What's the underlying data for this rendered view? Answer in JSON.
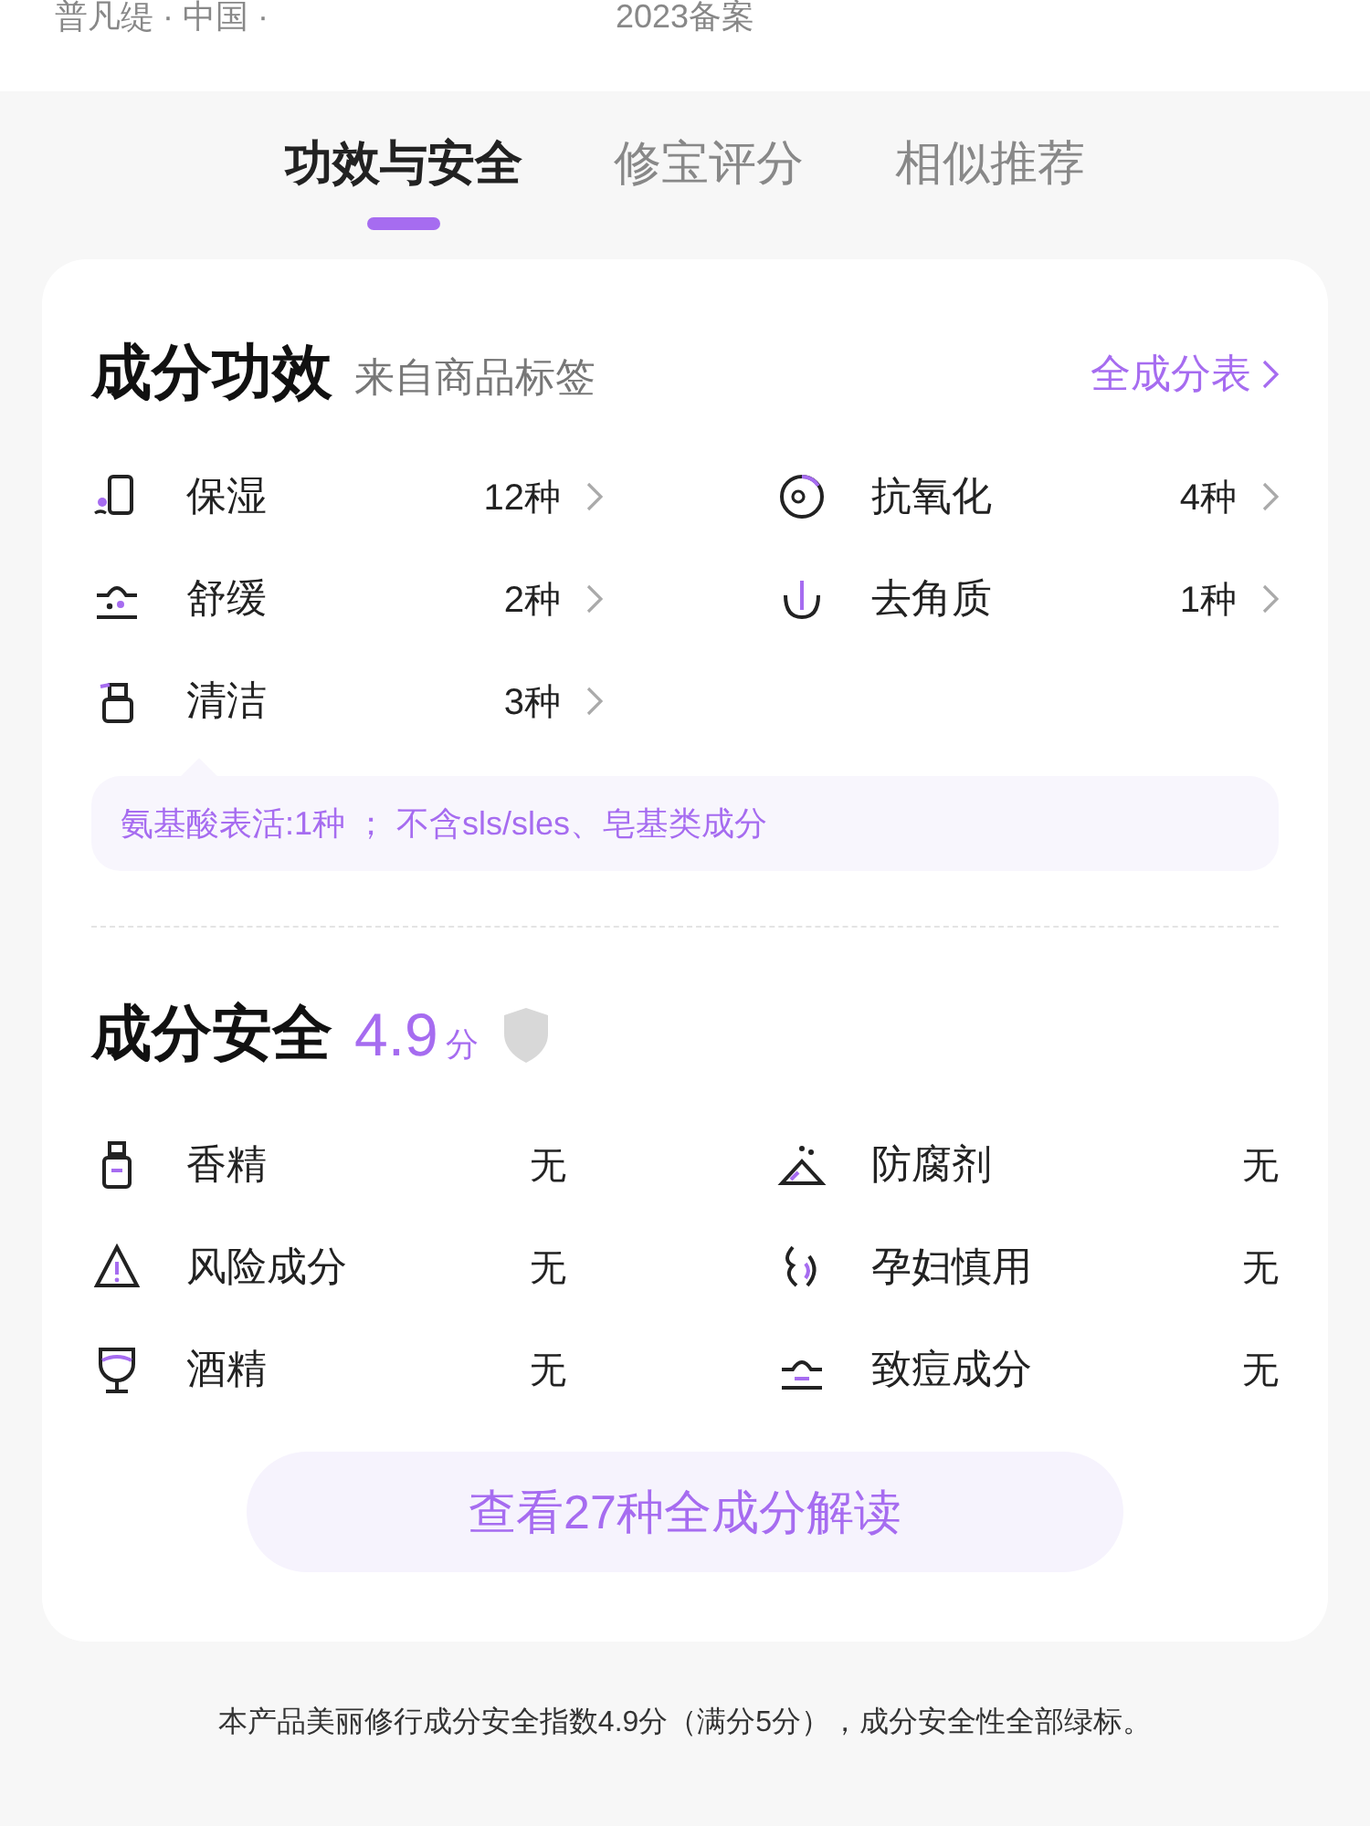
{
  "header": {
    "origin": "普凡缇 · 中国 ·",
    "filing": "2023备案"
  },
  "tabs": [
    {
      "label": "功效与安全",
      "selected": true
    },
    {
      "label": "修宝评分",
      "selected": false
    },
    {
      "label": "相似推荐",
      "selected": false
    }
  ],
  "efficacy": {
    "title": "成分功效",
    "subtitle": "来自商品标签",
    "link": "全成分表",
    "items": [
      {
        "kind": "moisture",
        "label": "保湿",
        "count": "12种"
      },
      {
        "kind": "antioxidant",
        "label": "抗氧化",
        "count": "4种"
      },
      {
        "kind": "soothing",
        "label": "舒缓",
        "count": "2种"
      },
      {
        "kind": "exfoliate",
        "label": "去角质",
        "count": "1种"
      },
      {
        "kind": "cleansing",
        "label": "清洁",
        "count": "3种"
      }
    ],
    "note": "氨基酸表活:1种 ； 不含sls/sles、皂基类成分"
  },
  "safety": {
    "title": "成分安全",
    "score": "4.9",
    "unit": "分",
    "items": [
      {
        "kind": "fragrance",
        "label": "香精",
        "value": "无"
      },
      {
        "kind": "preservative",
        "label": "防腐剂",
        "value": "无"
      },
      {
        "kind": "risk",
        "label": "风险成分",
        "value": "无"
      },
      {
        "kind": "pregnancy",
        "label": "孕妇慎用",
        "value": "无"
      },
      {
        "kind": "alcohol",
        "label": "酒精",
        "value": "无"
      },
      {
        "kind": "acne",
        "label": "致痘成分",
        "value": "无"
      }
    ]
  },
  "button": "查看27种全成分解读",
  "footer": "本产品美丽修行成分安全指数4.9分（满分5分），成分安全性全部绿标。"
}
